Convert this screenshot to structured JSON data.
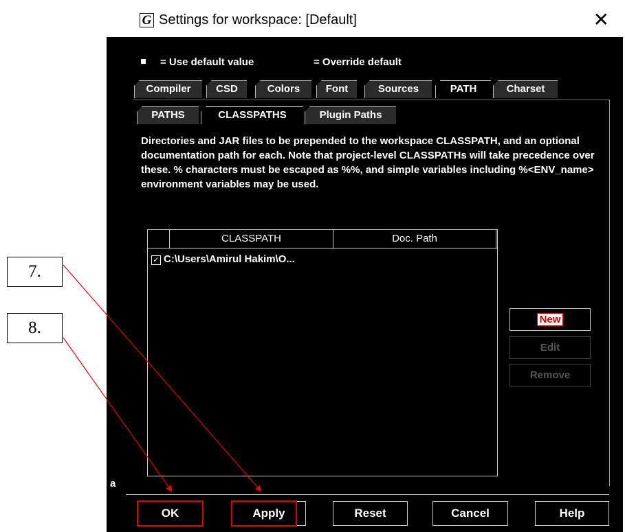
{
  "window": {
    "icon_letter": "G",
    "title": "Settings for workspace: [Default]",
    "close_glyph": "✕"
  },
  "legend": {
    "default_text": "= Use default value",
    "override_text": "= Override default"
  },
  "tabs_main": [
    {
      "label": "Compiler"
    },
    {
      "label": "CSD"
    },
    {
      "label": "Colors"
    },
    {
      "label": "Font"
    },
    {
      "label": "Sources"
    },
    {
      "label": "PATH",
      "active": true
    },
    {
      "label": "Charset"
    }
  ],
  "tabs_sub": [
    {
      "label": "PATHS"
    },
    {
      "label": "CLASSPATHS",
      "active": true
    },
    {
      "label": "Plugin Paths"
    }
  ],
  "description": "Directories and JAR files to be prepended to the workspace CLASSPATH, and an optional documentation path for each. Note that project-level CLASSPATHs will take precedence over these. % characters must be escaped as %%, and simple variables including %<ENV_name> environment variables may be used.",
  "table": {
    "columns": [
      "CLASSPATH",
      "Doc. Path"
    ],
    "rows": [
      {
        "checked": true,
        "classpath": "C:\\Users\\Amirul Hakim\\O...",
        "doc_path": ""
      }
    ]
  },
  "side_buttons": {
    "new": "New",
    "edit": "Edit",
    "remove": "Remove"
  },
  "bottom_buttons": {
    "ok": "OK",
    "apply": "Apply",
    "reset": "Reset",
    "cancel": "Cancel",
    "help": "Help"
  },
  "left_fragment": "a",
  "annotations": {
    "step7": "7.",
    "step8": "8."
  },
  "colors": {
    "background": "#000000",
    "highlight": "#e00000",
    "text": "#ffffff"
  }
}
